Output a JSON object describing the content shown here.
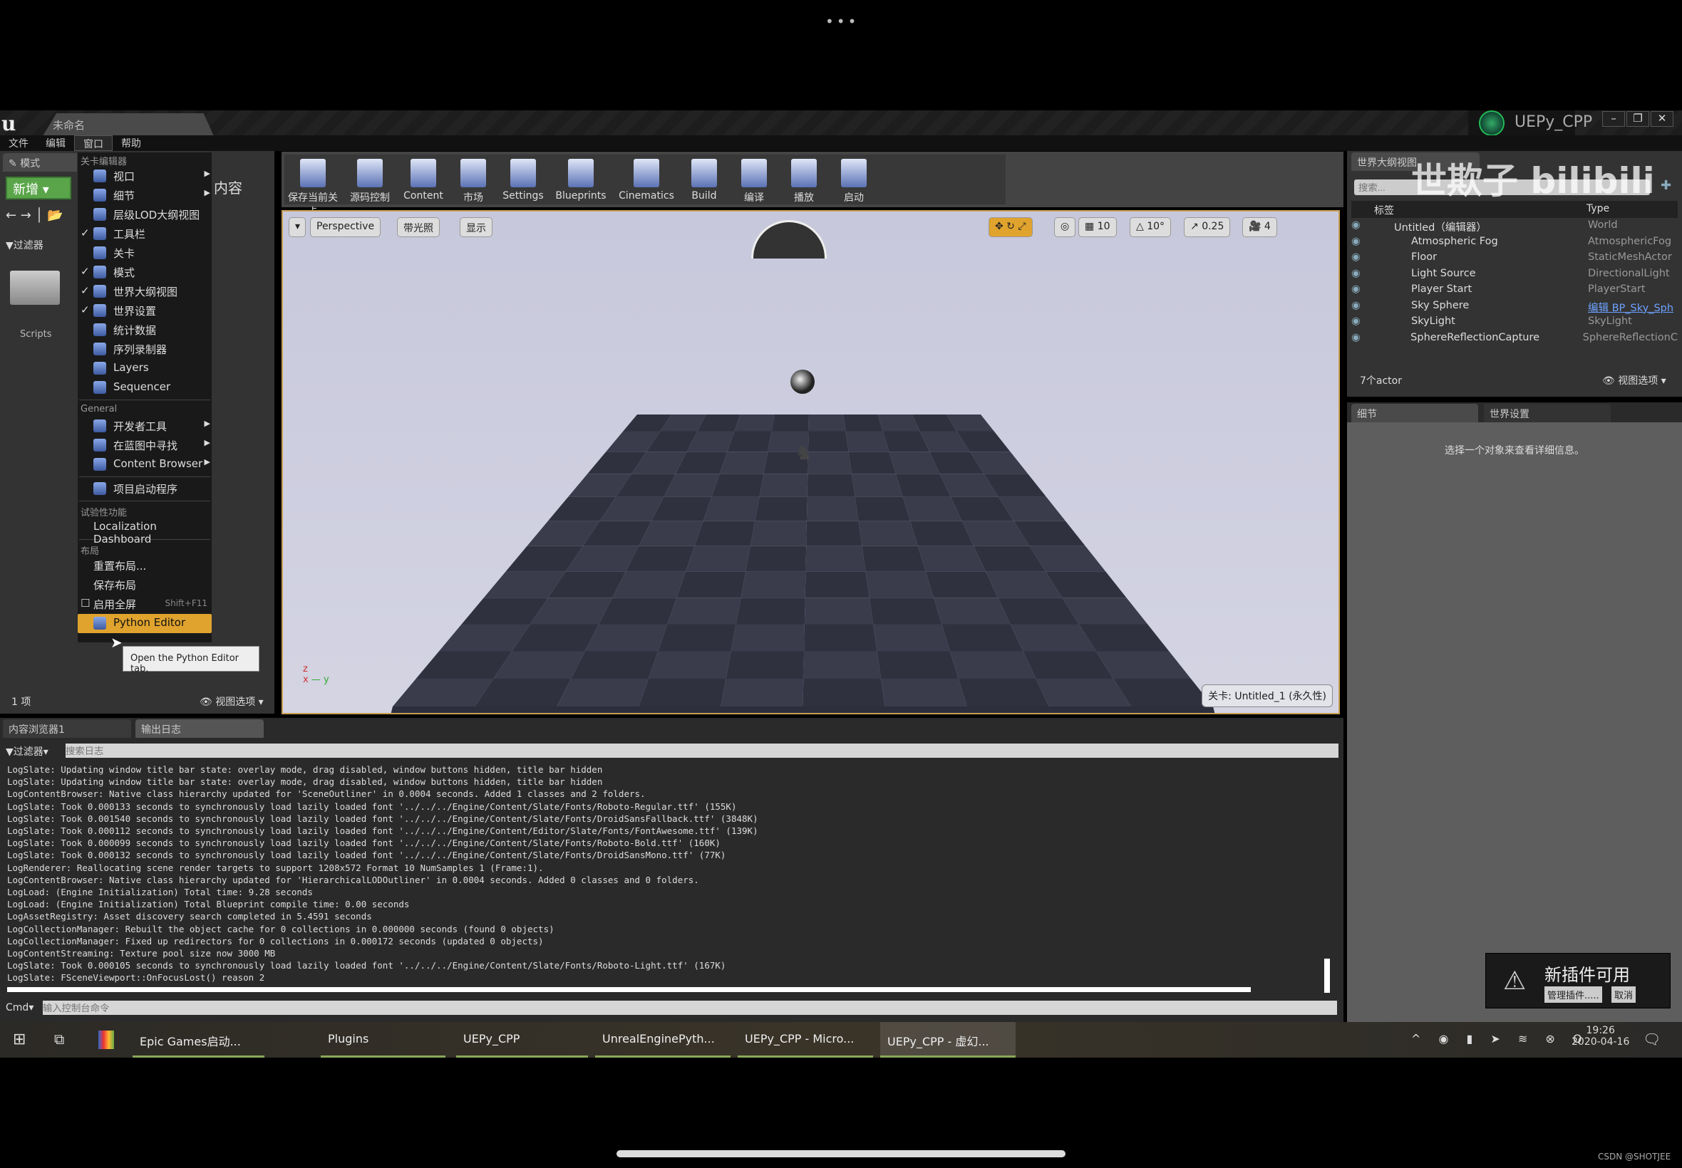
{
  "window": {
    "doc_tab": "未命名",
    "project": "UEPy_CPP",
    "controls": [
      "–",
      "❐",
      "✕"
    ]
  },
  "menubar": [
    "文件",
    "编辑",
    "窗口",
    "帮助"
  ],
  "left_panel": {
    "modes_tab": "模式",
    "new_button": "新增",
    "filter": "过滤器",
    "content_label": "内容",
    "folder": "Scripts",
    "count": "1 项",
    "view_options": "视图选项"
  },
  "window_menu": {
    "sections": [
      {
        "title": "关卡编辑器",
        "items": [
          {
            "label": "视口",
            "checked": false,
            "submenu": true,
            "icon": "viewport-icon"
          },
          {
            "label": "细节",
            "checked": false,
            "submenu": true,
            "icon": "details-icon"
          },
          {
            "label": "层级LOD大纲视图",
            "checked": false,
            "icon": "layers-icon"
          },
          {
            "label": "工具栏",
            "checked": true,
            "icon": "tools-icon"
          },
          {
            "label": "关卡",
            "checked": false,
            "icon": "level-icon"
          },
          {
            "label": "模式",
            "checked": true,
            "icon": "modes-icon"
          },
          {
            "label": "世界大纲视图",
            "checked": true,
            "icon": "outliner-icon"
          },
          {
            "label": "世界设置",
            "checked": true,
            "icon": "globe-icon"
          },
          {
            "label": "统计数据",
            "checked": false,
            "icon": "stats-icon"
          },
          {
            "label": "序列录制器",
            "checked": false,
            "icon": "record-icon"
          },
          {
            "label": "Layers",
            "checked": false,
            "icon": "layers-icon"
          },
          {
            "label": "Sequencer",
            "checked": false,
            "icon": "sequencer-icon"
          }
        ]
      },
      {
        "title": "General",
        "items": [
          {
            "label": "开发者工具",
            "submenu": true,
            "icon": "dev-tools-icon"
          },
          {
            "label": "在蓝图中寻找",
            "submenu": true,
            "icon": "search-icon"
          },
          {
            "label": "Content Browser",
            "submenu": true,
            "icon": "content-browser-icon"
          },
          {
            "label": "项目启动程序",
            "icon": "launcher-icon",
            "divider_before": true
          }
        ]
      },
      {
        "title": "试验性功能",
        "items": [
          {
            "label": "Localization Dashboard"
          }
        ]
      },
      {
        "title": "布局",
        "items": [
          {
            "label": "重置布局..."
          },
          {
            "label": "保存布局"
          },
          {
            "label": "启用全屏",
            "checkbox": true,
            "shortcut": "Shift+F11"
          },
          {
            "label": "Python Editor",
            "icon": "python-icon",
            "highlighted": true
          }
        ]
      }
    ],
    "tooltip": "Open the Python Editor tab."
  },
  "toolbar": [
    "保存当前关卡",
    "源码控制",
    "Content",
    "市场",
    "Settings",
    "Blueprints",
    "Cinematics",
    "Build",
    "编译",
    "播放",
    "启动"
  ],
  "viewport": {
    "perspective": "Perspective",
    "lit": "带光照",
    "show": "显示",
    "grid_snap": "10",
    "rot_snap": "10°",
    "scale_snap": "0.25",
    "cam_speed": "4",
    "level": "关卡: Untitled_1 (永久性)"
  },
  "outliner": {
    "tab": "世界大纲视图",
    "search_placeholder": "搜索...",
    "col_label": "标签",
    "col_type": "Type",
    "rows": [
      {
        "name": "Untitled（编辑器）",
        "type": "World"
      },
      {
        "name": "Atmospheric Fog",
        "type": "AtmosphericFog"
      },
      {
        "name": "Floor",
        "type": "StaticMeshActor"
      },
      {
        "name": "Light Source",
        "type": "DirectionalLight"
      },
      {
        "name": "Player Start",
        "type": "PlayerStart"
      },
      {
        "name": "Sky Sphere",
        "type": "编辑 BP_Sky_Sph"
      },
      {
        "name": "SkyLight",
        "type": "SkyLight"
      },
      {
        "name": "SphereReflectionCapture",
        "type": "SphereReflectionC"
      }
    ],
    "count": "7个actor",
    "view_options": "视图选项"
  },
  "watermark": "世欺子 bilibili",
  "details": {
    "tab1": "细节",
    "tab2": "世界设置",
    "empty": "选择一个对象来查看详细信息。"
  },
  "bottom": {
    "tab1": "内容浏览器1",
    "tab2": "输出日志",
    "filter": "过滤器",
    "search_placeholder": "搜索日志",
    "cmd": "Cmd",
    "cmd_placeholder": "输入控制台命令",
    "log": [
      "LogSlate: Updating window title bar state: overlay mode, drag disabled, window buttons hidden, title bar hidden",
      "LogSlate: Updating window title bar state: overlay mode, drag disabled, window buttons hidden, title bar hidden",
      "LogContentBrowser: Native class hierarchy updated for 'SceneOutliner' in 0.0004 seconds. Added 1 classes and 2 folders.",
      "LogSlate: Took 0.000133 seconds to synchronously load lazily loaded font '../../../Engine/Content/Slate/Fonts/Roboto-Regular.ttf' (155K)",
      "LogSlate: Took 0.001540 seconds to synchronously load lazily loaded font '../../../Engine/Content/Slate/Fonts/DroidSansFallback.ttf' (3848K)",
      "LogSlate: Took 0.000112 seconds to synchronously load lazily loaded font '../../../Engine/Content/Editor/Slate/Fonts/FontAwesome.ttf' (139K)",
      "LogSlate: Took 0.000099 seconds to synchronously load lazily loaded font '../../../Engine/Content/Slate/Fonts/Roboto-Bold.ttf' (160K)",
      "LogSlate: Took 0.000132 seconds to synchronously load lazily loaded font '../../../Engine/Content/Slate/Fonts/DroidSansMono.ttf' (77K)",
      "LogRenderer: Reallocating scene render targets to support 1208x572 Format 10 NumSamples 1 (Frame:1).",
      "LogContentBrowser: Native class hierarchy updated for 'HierarchicalLODOutliner' in 0.0004 seconds. Added 0 classes and 0 folders.",
      "LogLoad: (Engine Initialization) Total time: 9.28 seconds",
      "LogLoad: (Engine Initialization) Total Blueprint compile time: 0.00 seconds",
      "LogAssetRegistry: Asset discovery search completed in 5.4591 seconds",
      "LogCollectionManager: Rebuilt the object cache for 0 collections in 0.000000 seconds (found 0 objects)",
      "LogCollectionManager: Fixed up redirectors for 0 collections in 0.000172 seconds (updated 0 objects)",
      "LogContentStreaming: Texture pool size now 3000 MB",
      "LogSlate: Took 0.000105 seconds to synchronously load lazily loaded font '../../../Engine/Content/Slate/Fonts/Roboto-Light.ttf' (167K)",
      "LogSlate: FSceneViewport::OnFocusLost() reason 2"
    ]
  },
  "notification": {
    "title": "新插件可用",
    "manage": "管理插件.....",
    "cancel": "取消"
  },
  "taskbar": {
    "apps": [
      "Epic Games启动...",
      "",
      "Plugins",
      "UEPy_CPP",
      "UnrealEnginePyth...",
      "UEPy_CPP - Micro...",
      "UEPy_CPP - 虚幻..."
    ],
    "time": "19:26",
    "date": "2020-04-16"
  },
  "footer_watermark": "CSDN @SHOTJEE",
  "colors": {
    "accent": "#e0a32e",
    "new_button": "#5aa54a",
    "viewport_border": "#c8a056"
  }
}
